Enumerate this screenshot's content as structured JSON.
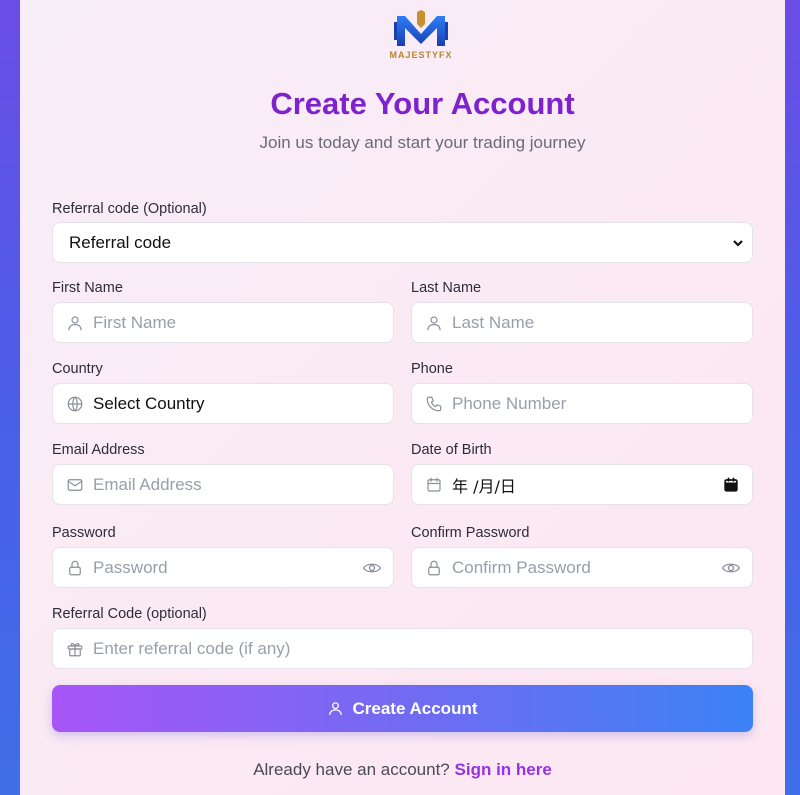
{
  "brand": {
    "name": "MAJESTYFX"
  },
  "header": {
    "title": "Create Your Account",
    "subtitle": "Join us today and start your trading journey"
  },
  "form": {
    "referral_select": {
      "label": "Referral code (Optional)",
      "value": "Referral code"
    },
    "first_name": {
      "label": "First Name",
      "placeholder": "First Name"
    },
    "last_name": {
      "label": "Last Name",
      "placeholder": "Last Name"
    },
    "country": {
      "label": "Country",
      "value": "Select Country"
    },
    "phone": {
      "label": "Phone",
      "placeholder": "Phone Number"
    },
    "email": {
      "label": "Email Address",
      "placeholder": "Email Address"
    },
    "dob": {
      "label": "Date of Birth",
      "value": "年 /月/日"
    },
    "password": {
      "label": "Password",
      "placeholder": "Password"
    },
    "confirm_password": {
      "label": "Confirm Password",
      "placeholder": "Confirm Password"
    },
    "referral_code": {
      "label": "Referral Code (optional)",
      "placeholder": "Enter referral code (if any)"
    },
    "submit_label": "Create Account"
  },
  "footer": {
    "prompt": "Already have an account?",
    "link": "Sign in here"
  },
  "colors": {
    "accent": "#7e22ce",
    "link": "#9333ea",
    "button_start": "#a855f7",
    "button_end": "#3b82f6"
  }
}
